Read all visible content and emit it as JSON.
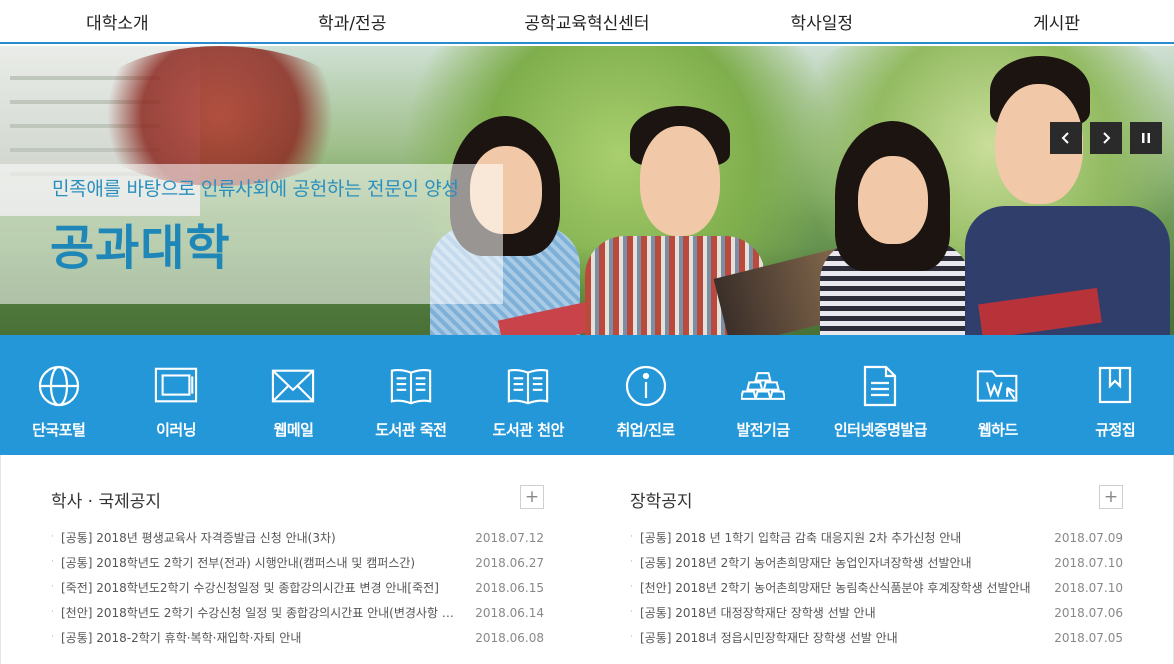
{
  "nav": {
    "items": [
      "대학소개",
      "학과/전공",
      "공학교육혁신센터",
      "학사일정",
      "게시판"
    ]
  },
  "hero": {
    "slogan": "민족애를 바탕으로 인류사회에 공헌하는 전문인 양성",
    "title": "공과대학",
    "controls": {
      "prev": "‹",
      "next": "›",
      "pause": "❚❚"
    }
  },
  "quick_links": [
    {
      "label": "단국포털",
      "icon": "globe-icon"
    },
    {
      "label": "이러닝",
      "icon": "monitor-icon"
    },
    {
      "label": "웹메일",
      "icon": "envelope-icon"
    },
    {
      "label": "도서관 죽전",
      "icon": "open-book-icon"
    },
    {
      "label": "도서관 천안",
      "icon": "open-book-icon"
    },
    {
      "label": "취업/진로",
      "icon": "info-icon"
    },
    {
      "label": "발전기금",
      "icon": "gold-bars-icon"
    },
    {
      "label": "인터넷증명발급",
      "icon": "document-icon"
    },
    {
      "label": "웹하드",
      "icon": "folder-w-icon"
    },
    {
      "label": "규정집",
      "icon": "bookmark-icon"
    }
  ],
  "boards": {
    "academic": {
      "title": "학사 · 국제공지",
      "more": "+",
      "items": [
        {
          "subject": "[공통] 2018년 평생교육사 자격증발급 신청 안내(3차)",
          "date": "2018.07.12"
        },
        {
          "subject": "[공통] 2018학년도 2학기 전부(전과) 시행안내(캠퍼스내 및 캠퍼스간)",
          "date": "2018.06.27"
        },
        {
          "subject": "[죽전] 2018학년도2학기 수강신청일정 및 종합강의시간표 변경 안내[죽전]",
          "date": "2018.06.15"
        },
        {
          "subject": "[천안] 2018학년도 2학기 수강신청 일정 및 종합강의시간표 안내(변경사항 …",
          "date": "2018.06.14"
        },
        {
          "subject": "[공통] 2018-2학기 휴학·복학·재입학·자퇴 안내",
          "date": "2018.06.08"
        }
      ]
    },
    "scholarship": {
      "title": "장학공지",
      "more": "+",
      "items": [
        {
          "subject": "[공통] 2018 년 1학기 입학금 감축 대응지원 2차 추가신청 안내",
          "date": "2018.07.09"
        },
        {
          "subject": "[공통] 2018년 2학기 농어촌희망재단 농업인자녀장학생 선발안내",
          "date": "2018.07.10"
        },
        {
          "subject": "[천안] 2018년 2학기 농어촌희망재단 농림축산식품분야 후계장학생 선발안내",
          "date": "2018.07.10"
        },
        {
          "subject": "[공통] 2018년 대정장학재단 장학생 선발 안내",
          "date": "2018.07.06"
        },
        {
          "subject": "[공통] 2018녀 정읍시민장학재단 장학생 선발 안내",
          "date": "2018.07.05"
        }
      ]
    }
  },
  "colors": {
    "accent": "#2497d9",
    "title_blue": "#1f87b8",
    "nav_border": "#2a8ccf"
  }
}
